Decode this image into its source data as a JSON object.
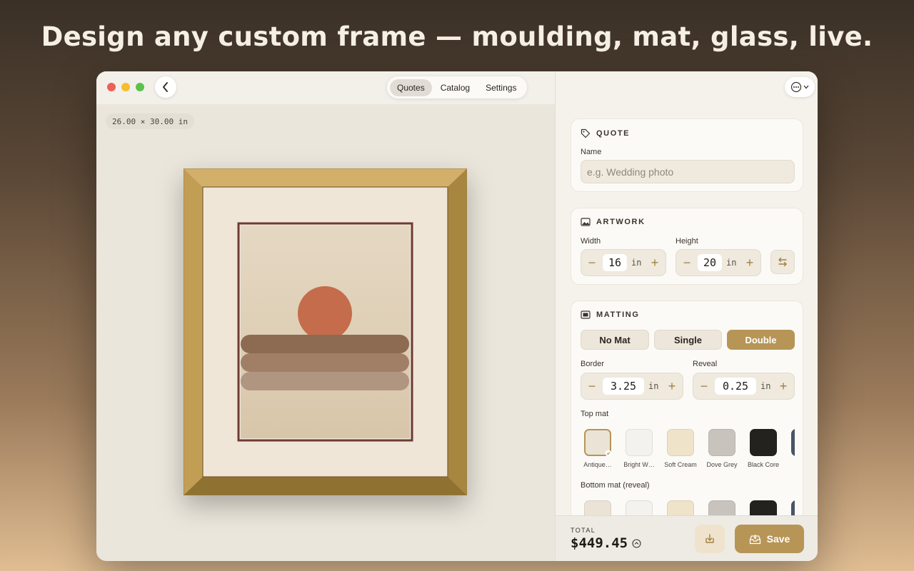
{
  "headline": "Design any custom frame — moulding, mat, glass, live.",
  "nav": {
    "tabs": [
      {
        "label": "Quotes",
        "active": true
      },
      {
        "label": "Catalog",
        "active": false
      },
      {
        "label": "Settings",
        "active": false
      }
    ]
  },
  "canvas": {
    "dimensions": "26.00 × 30.00 in"
  },
  "quote": {
    "heading": "QUOTE",
    "name_label": "Name",
    "name_placeholder": "e.g. Wedding photo",
    "name_value": ""
  },
  "artwork": {
    "heading": "ARTWORK",
    "width_label": "Width",
    "width_value": "16",
    "height_label": "Height",
    "height_value": "20",
    "unit": "in"
  },
  "matting": {
    "heading": "MATTING",
    "options": [
      {
        "label": "No Mat",
        "active": false
      },
      {
        "label": "Single",
        "active": false
      },
      {
        "label": "Double",
        "active": true
      }
    ],
    "border_label": "Border",
    "border_value": "3.25",
    "reveal_label": "Reveal",
    "reveal_value": "0.25",
    "unit": "in",
    "top_mat_label": "Top mat",
    "top_mat_swatches": [
      {
        "label": "Antique…",
        "color": "#ebe3d6",
        "selected": true
      },
      {
        "label": "Bright W…",
        "color": "#f4f2ee",
        "selected": false
      },
      {
        "label": "Soft Cream",
        "color": "#efe3c9",
        "selected": false
      },
      {
        "label": "Dove Grey",
        "color": "#c8c3bd",
        "selected": false
      },
      {
        "label": "Black Core",
        "color": "#24221f",
        "selected": false
      },
      {
        "label": "S",
        "color": "#4a5566",
        "selected": false
      }
    ],
    "bottom_mat_label": "Bottom mat (reveal)",
    "bottom_mat_swatches": [
      {
        "color": "#ebe3d6"
      },
      {
        "color": "#f4f2ee"
      },
      {
        "color": "#efe3c9"
      },
      {
        "color": "#c8c3bd"
      },
      {
        "color": "#24221f"
      },
      {
        "color": "#4a5566"
      }
    ]
  },
  "footer": {
    "total_label": "TOTAL",
    "total_value": "$449.45",
    "save_label": "Save"
  },
  "colors": {
    "accent": "#b79556",
    "frame_gold": "#c9a65c",
    "mat": "#efe6d8",
    "inner_mat_line": "#6e3b32",
    "sun": "#c46c4b"
  }
}
